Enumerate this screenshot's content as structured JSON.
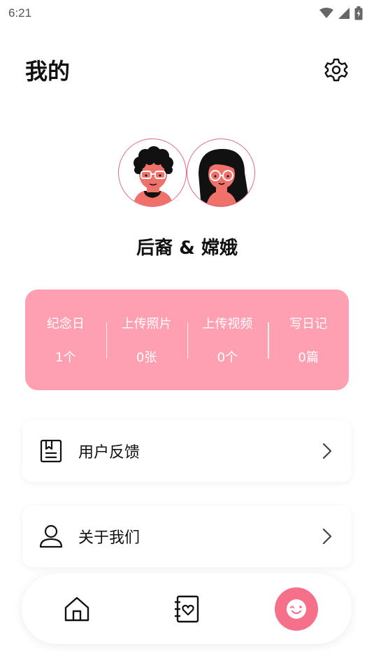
{
  "status_bar": {
    "time": "6:21",
    "icons": [
      "wifi-icon",
      "signal-icon",
      "battery-icon"
    ]
  },
  "header": {
    "title": "我的",
    "settings_icon": "gear-icon"
  },
  "profile": {
    "avatars": [
      "boy-avatar",
      "girl-avatar"
    ],
    "names": "后裔 & 嫦娥",
    "accent_color": "#e06a8a"
  },
  "stats": {
    "card_color": "#ff9fb2",
    "items": [
      {
        "label": "纪念日",
        "value": "1个"
      },
      {
        "label": "上传照片",
        "value": "0张"
      },
      {
        "label": "上传视频",
        "value": "0个"
      },
      {
        "label": "写日记",
        "value": "0篇"
      }
    ]
  },
  "menu": {
    "items": [
      {
        "label": "用户反馈",
        "icon": "feedback-icon"
      },
      {
        "label": "关于我们",
        "icon": "user-icon"
      }
    ]
  },
  "bottom_nav": {
    "items": [
      {
        "name": "home",
        "icon": "home-icon",
        "active": false
      },
      {
        "name": "diary",
        "icon": "diary-icon",
        "active": false
      },
      {
        "name": "mine",
        "icon": "smile-icon",
        "active": true
      }
    ],
    "active_color": "#f7708a"
  }
}
